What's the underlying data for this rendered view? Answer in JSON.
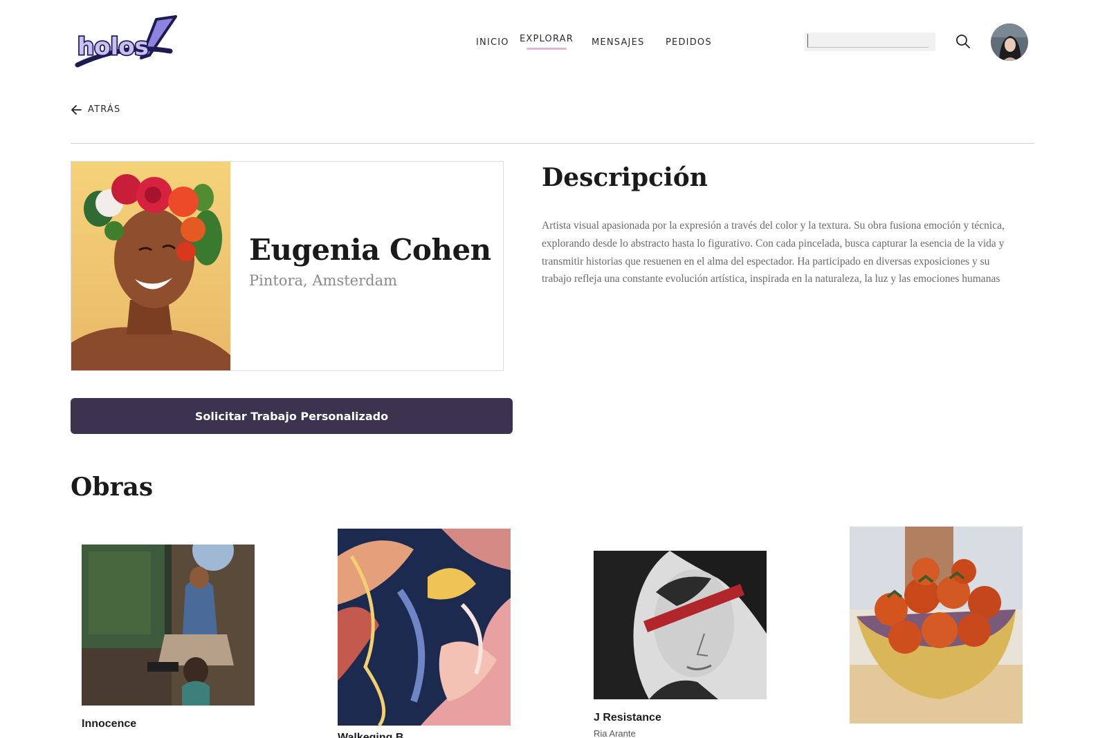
{
  "brand": {
    "logo_text": "holos"
  },
  "nav": {
    "items": [
      "INICIO",
      "EXPLORAR",
      "MENSAJES",
      "PEDIDOS"
    ],
    "active_index": 1,
    "active_underline_color": "#e7b3dc"
  },
  "search": {
    "value": "",
    "placeholder": ""
  },
  "back": {
    "label": "ATRÁS"
  },
  "artist": {
    "name": "Eugenia Cohen",
    "location": "Pintora, Amsterdam"
  },
  "cta": {
    "label": "Solicitar Trabajo Personalizado",
    "color": "#3c344f"
  },
  "description": {
    "title": "Descripción",
    "text": "Artista visual apasionada por la expresión a través del color y la textura. Su obra fusiona emoción y técnica, explorando desde lo abstracto hasta lo figurativo. Con cada pincelada, busca capturar la esencia de la vida y transmitir historias que resuenen en el alma del espectador. Ha participado en diversas exposiciones y su trabajo refleja una constante evolución artística, inspirada en la naturaleza, la luz y las emociones humanas"
  },
  "works": {
    "title": "Obras",
    "items": [
      {
        "title": "Innocence",
        "artist": ""
      },
      {
        "title": "Walkeging B...",
        "artist": ""
      },
      {
        "title": "J Resistance",
        "artist": "Ria Arante"
      },
      {
        "title": "",
        "artist": ""
      }
    ]
  }
}
